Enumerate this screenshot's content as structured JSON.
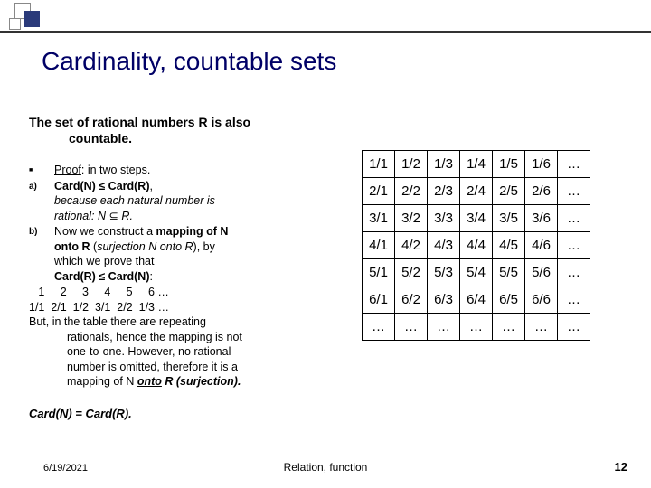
{
  "title": "Cardinality, countable sets",
  "subtitle_l1": "The set of rational numbers R is also",
  "subtitle_l2": "countable.",
  "proof_label": "Proof",
  "proof_tail": ": in two steps.",
  "step_a_marker": "a)",
  "step_a_l1a": "Card(N) ",
  "step_a_l1b": " Card(R)",
  "step_a_l1c": ",",
  "step_a_l2": "because each natural number is",
  "step_a_l3a": "rational: N ",
  "step_a_l3b": " R.",
  "step_b_marker": "b)",
  "step_b_l1a": "Now we construct a ",
  "step_b_l1b": "mapping of N",
  "step_b_l2a": "onto R",
  "step_b_l2b": " (",
  "step_b_l2c": "surjection N onto R",
  "step_b_l2d": "), by",
  "step_b_l3": "which we prove that",
  "step_b_l4a": "Card(R) ",
  "step_b_l4b": " Card(N)",
  "step_b_l4c": ":",
  "seq1": "   1     2     3     4     5     6 …",
  "seq2": "1/1  2/1  1/2  3/1  2/2  1/3 …",
  "but_l1": "But, in the table there are repeating",
  "but_l2": "rationals, hence the mapping is not",
  "but_l3": "one-to-one. However, no rational",
  "but_l4": "number is omitted, therefore it is a",
  "but_l5a": "mapping of N ",
  "but_l5b": "onto",
  "but_l5c": " R (surjection).",
  "conclusion": "Card(N) = Card(R).",
  "footer_date": "6/19/2021",
  "footer_center": "Relation, function",
  "footer_page": "12",
  "table": [
    [
      "1/1",
      "1/2",
      "1/3",
      "1/4",
      "1/5",
      "1/6",
      "…"
    ],
    [
      "2/1",
      "2/2",
      "2/3",
      "2/4",
      "2/5",
      "2/6",
      "…"
    ],
    [
      "3/1",
      "3/2",
      "3/3",
      "3/4",
      "3/5",
      "3/6",
      "…"
    ],
    [
      "4/1",
      "4/2",
      "4/3",
      "4/4",
      "4/5",
      "4/6",
      "…"
    ],
    [
      "5/1",
      "5/2",
      "5/3",
      "5/4",
      "5/5",
      "5/6",
      "…"
    ],
    [
      "6/1",
      "6/2",
      "6/3",
      "6/4",
      "6/5",
      "6/6",
      "…"
    ],
    [
      "…",
      "…",
      "…",
      "…",
      "…",
      "…",
      "…"
    ]
  ],
  "le_symbol": "≤",
  "subset_symbol": "⊆"
}
